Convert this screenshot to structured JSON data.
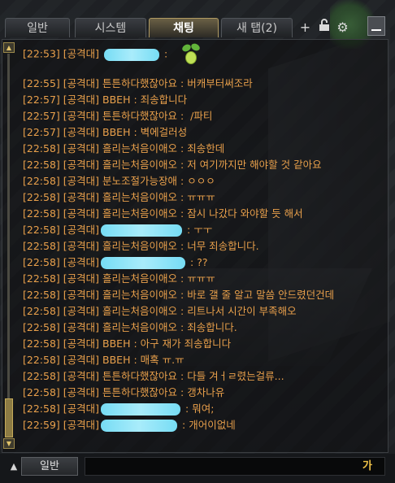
{
  "tabs": [
    {
      "label": "일반",
      "active": false
    },
    {
      "label": "시스템",
      "active": false
    },
    {
      "label": "채팅",
      "active": true
    },
    {
      "label": "새 탭(2)",
      "active": false
    }
  ],
  "tab_icons": [
    "plus-icon",
    "lock-icon",
    "gear-icon",
    "minimize-icon"
  ],
  "chat_lines": [
    {
      "time": "[22:53]",
      "channel": "[공격대]",
      "name": "",
      "name_hidden": true,
      "sep": " :",
      "text": ""
    },
    {
      "time": "[22:55]",
      "channel": "[공격대]",
      "name": "튼튼하다했잖아요",
      "sep": " : ",
      "text": "버캐부터써조라"
    },
    {
      "time": "[22:57]",
      "channel": "[공격대]",
      "name": "BBEH",
      "sep": " : ",
      "text": "죄송합니다"
    },
    {
      "time": "[22:57]",
      "channel": "[공격대]",
      "name": "튼튼하다했잖아요",
      "sep": " :  ",
      "text": "/파티"
    },
    {
      "time": "[22:57]",
      "channel": "[공격대]",
      "name": "BBEH",
      "sep": " : ",
      "text": "벽에걸러성"
    },
    {
      "time": "[22:58]",
      "channel": "[공격대]",
      "name": "흘리는처음이애오",
      "sep": " : ",
      "text": "죄송한데"
    },
    {
      "time": "[22:58]",
      "channel": "[공격대]",
      "name": "흘리는처음이애오",
      "sep": " : ",
      "text": "저 여기까지만 해야할 것 같아요"
    },
    {
      "time": "[22:58]",
      "channel": "[공격대]",
      "name": "분노조절가능장애",
      "sep": " : ",
      "text": "ㅇㅇㅇ"
    },
    {
      "time": "[22:58]",
      "channel": "[공격대]",
      "name": "흘리는처음이애오",
      "sep": " : ",
      "text": "ㅠㅠㅠ"
    },
    {
      "time": "[22:58]",
      "channel": "[공격대]",
      "name": "흘리는처음이애오",
      "sep": " : ",
      "text": "잠시 나갔다 와야할 듯 해서"
    },
    {
      "time": "[22:58]",
      "channel": "[공격대]",
      "name": "",
      "name_hidden": true,
      "sep": " : ",
      "text": "ㅜㅜ"
    },
    {
      "time": "[22:58]",
      "channel": "[공격대]",
      "name": "흘리는처음이애오",
      "sep": " : ",
      "text": "너무 죄송합니다."
    },
    {
      "time": "[22:58]",
      "channel": "[공격대]",
      "name": "",
      "name_hidden": true,
      "sep": " : ",
      "text": "??"
    },
    {
      "time": "[22:58]",
      "channel": "[공격대]",
      "name": "흘리는처음이애오",
      "sep": " : ",
      "text": "ㅠㅠㅠ"
    },
    {
      "time": "[22:58]",
      "channel": "[공격대]",
      "name": "흘리는처음이애오",
      "sep": " : ",
      "text": "바로 갤 줄 알고 말씀 안드렸던건데"
    },
    {
      "time": "[22:58]",
      "channel": "[공격대]",
      "name": "흘리는처음이애오",
      "sep": " : ",
      "text": "리트나서 시간이 부족해오"
    },
    {
      "time": "[22:58]",
      "channel": "[공격대]",
      "name": "흘리는처음이애오",
      "sep": " : ",
      "text": "죄송합니다."
    },
    {
      "time": "[22:58]",
      "channel": "[공격대]",
      "name": "BBEH",
      "sep": " : ",
      "text": "아구 재가 죄송합니다"
    },
    {
      "time": "[22:58]",
      "channel": "[공격대]",
      "name": "BBEH",
      "sep": " : ",
      "text": "매혹 ㅠ.ㅠ"
    },
    {
      "time": "[22:58]",
      "channel": "[공격대]",
      "name": "튼튼하다했잖아요",
      "sep": " : ",
      "text": "다들 겨ㅓㄹ렸는걸류..."
    },
    {
      "time": "[22:58]",
      "channel": "[공격대]",
      "name": "튼튼하다했잖아요",
      "sep": " : ",
      "text": "갱차나유"
    },
    {
      "time": "[22:58]",
      "channel": "[공격대]",
      "name": "",
      "name_hidden": true,
      "sep": " : ",
      "text": "뭐여;"
    },
    {
      "time": "[22:59]",
      "channel": "[공격대]",
      "name": "",
      "name_hidden": true,
      "sep": " : ",
      "text": "개어이없네"
    }
  ],
  "bottom": {
    "channel_label": "일반",
    "ime_indicator": "가",
    "input_value": ""
  },
  "colors": {
    "chat_text": "#e9a04b",
    "redaction": "#8fe3f7",
    "active_tab_border": "#b09a62"
  }
}
